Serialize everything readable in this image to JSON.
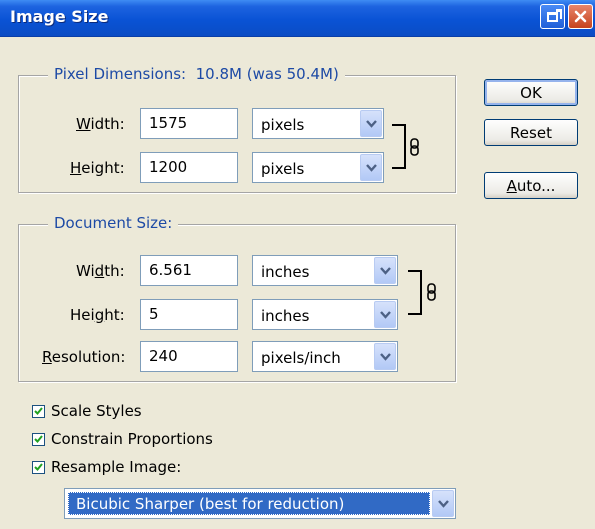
{
  "window": {
    "title": "Image Size"
  },
  "pixel_dimensions": {
    "legend": "Pixel Dimensions:",
    "size": "10.8M (was 50.4M)",
    "width_label": "Width:",
    "width_value": "1575",
    "width_unit": "pixels",
    "height_label": "Height:",
    "height_value": "1200",
    "height_unit": "pixels"
  },
  "document_size": {
    "legend": "Document Size:",
    "width_label": "Width:",
    "width_value": "6.561",
    "width_unit": "inches",
    "height_label": "Height:",
    "height_value": "5",
    "height_unit": "inches",
    "resolution_label": "Resolution:",
    "resolution_value": "240",
    "resolution_unit": "pixels/inch"
  },
  "buttons": {
    "ok": "OK",
    "reset": "Reset",
    "auto": "Auto..."
  },
  "options": {
    "scale_styles": {
      "label": "Scale Styles",
      "checked": true
    },
    "constrain_proportions": {
      "label": "Constrain Proportions",
      "checked": true
    },
    "resample_image": {
      "label": "Resample Image:",
      "checked": true
    }
  },
  "resample_method": "Bicubic Sharper (best for reduction)",
  "colors": {
    "accent": "#1d4aa5",
    "selection": "#316ac5",
    "titlebar": "#0a53d5"
  }
}
